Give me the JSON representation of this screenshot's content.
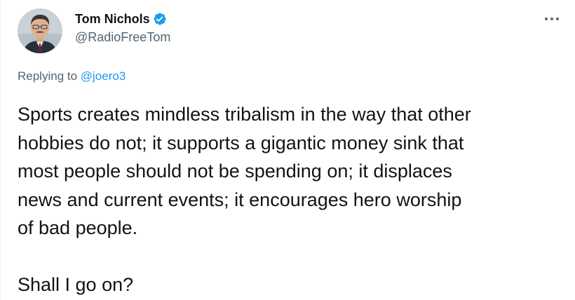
{
  "tweet": {
    "author": {
      "display_name": "Tom Nichols",
      "handle": "@RadioFreeTom",
      "verified": true
    },
    "more_icon": "more-horizontal-icon",
    "replying_prefix": "Replying to",
    "replying_to": "@joero3",
    "text_lines": [
      "Sports creates mindless tribalism in the way that other",
      "hobbies do not; it supports a gigantic money sink that",
      "most people should not be spending on; it displaces",
      "news and current events; it encourages hero worship",
      "of bad people.",
      "",
      "Shall I go on?"
    ],
    "colors": {
      "accent": "#1d9bf0",
      "text": "#0f1419",
      "secondary": "#536471"
    }
  }
}
